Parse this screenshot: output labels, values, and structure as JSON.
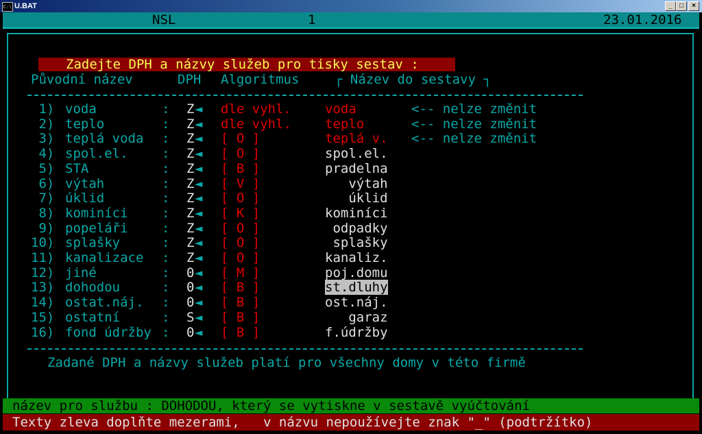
{
  "window": {
    "title": "U.BAT",
    "minimize": "_",
    "maximize": "□",
    "close": "×"
  },
  "status": {
    "left": "NSL",
    "page": "1",
    "date": "23.01.2016"
  },
  "header_title": "Zadejte DPH a názvy služeb pro tisky sestav :",
  "columns": {
    "name": "Původní název",
    "dph": "DPH",
    "algo": "Algoritmus",
    "print_name": "┌ Název do sestavy ┐"
  },
  "rows": [
    {
      "num": " 1)",
      "name": "voda",
      "dph": "Z",
      "algo": "dle vyhl.",
      "print_name": "voda",
      "note": "<-- nelze změnit"
    },
    {
      "num": " 2)",
      "name": "teplo",
      "dph": "Z",
      "algo": "dle vyhl.",
      "print_name": "teplo",
      "note": "<-- nelze změnit"
    },
    {
      "num": " 3)",
      "name": "teplá voda",
      "dph": "Z",
      "algo": "[ O ]",
      "print_name": "teplá v.",
      "note": "<-- nelze změnit"
    },
    {
      "num": " 4)",
      "name": "spol.el.",
      "dph": "Z",
      "algo": "[ O ]",
      "print_name": "spol.el.",
      "note": ""
    },
    {
      "num": " 5)",
      "name": "STA",
      "dph": "Z",
      "algo": "[ B ]",
      "print_name": "pradelna",
      "note": ""
    },
    {
      "num": " 6)",
      "name": "výtah",
      "dph": "Z",
      "algo": "[ V ]",
      "print_name": "   výtah",
      "note": ""
    },
    {
      "num": " 7)",
      "name": "úklid",
      "dph": "Z",
      "algo": "[ O ]",
      "print_name": "   úklid",
      "note": ""
    },
    {
      "num": " 8)",
      "name": "kominíci",
      "dph": "Z",
      "algo": "[ K ]",
      "print_name": "kominíci",
      "note": ""
    },
    {
      "num": " 9)",
      "name": "popeláři",
      "dph": "Z",
      "algo": "[ O ]",
      "print_name": " odpadky",
      "note": ""
    },
    {
      "num": "10)",
      "name": "splašky",
      "dph": "Z",
      "algo": "[ O ]",
      "print_name": " splašky",
      "note": ""
    },
    {
      "num": "11)",
      "name": "kanalizace",
      "dph": "Z",
      "algo": "[ O ]",
      "print_name": "kanaliz.",
      "note": ""
    },
    {
      "num": "12)",
      "name": "jiné",
      "dph": "0",
      "algo": "[ M ]",
      "print_name": "poj.domu",
      "note": ""
    },
    {
      "num": "13)",
      "name": "dohodou",
      "dph": "0",
      "algo": "[ B ]",
      "print_name": "st.dluhy",
      "note": ""
    },
    {
      "num": "14)",
      "name": "ostat.náj.",
      "dph": "0",
      "algo": "[ B ]",
      "print_name": "ost.náj.",
      "note": ""
    },
    {
      "num": "15)",
      "name": "ostatní",
      "dph": "S",
      "algo": "[ B ]",
      "print_name": "   garaz",
      "note": ""
    },
    {
      "num": "16)",
      "name": "fond údržby",
      "dph": "0",
      "algo": "[ B ]",
      "print_name": "f.údržby",
      "note": ""
    }
  ],
  "selected_row": 12,
  "footer_note": "Zadané DPH a názvy služeb platí pro všechny domy v této firmě",
  "hint_line": "název pro službu : DOHODOU, který se vytiskne v sestavě vyúčtování",
  "help_line": "Texty zleva doplňte mezerami,   v názvu nepoužívejte znak \"_\" (podtržítko)",
  "colors": {
    "cyan": "#0aa8a8",
    "red": "#e00000",
    "white": "#e0e0e0",
    "yellow": "#fcfc54",
    "header_bg": "#8c0000",
    "hint_bg": "#0a8a0a"
  }
}
